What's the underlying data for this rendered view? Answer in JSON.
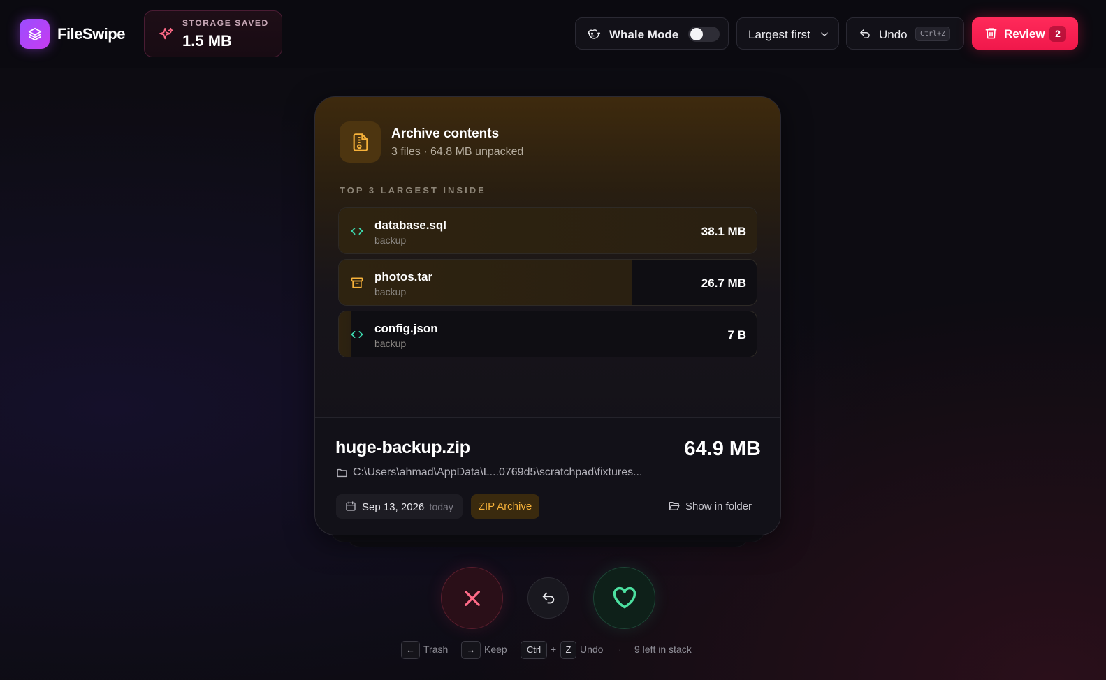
{
  "app": {
    "name": "FileSwipe"
  },
  "colors": {
    "accent": "#ff2a5a",
    "keep": "#4ce0a0",
    "trash": "#ff6b88",
    "archive": "#f7b23a",
    "code": "#3ddbb0"
  },
  "header": {
    "storage_saved_label": "STORAGE SAVED",
    "storage_saved_value": "1.5 MB",
    "whale_mode_label": "Whale Mode",
    "whale_mode_on": false,
    "sort_label": "Largest first",
    "undo_label": "Undo",
    "undo_shortcut": "Ctrl+Z",
    "review_label": "Review",
    "review_count": "2"
  },
  "card": {
    "archive_title": "Archive contents",
    "archive_subtitle": "3 files · 64.8 MB unpacked",
    "section_label": "TOP 3 LARGEST INSIDE",
    "files": [
      {
        "name": "database.sql",
        "category": "backup",
        "size": "38.1 MB",
        "icon": "code-icon",
        "fraction": 1.0
      },
      {
        "name": "photos.tar",
        "category": "backup",
        "size": "26.7 MB",
        "icon": "archive-box-icon",
        "fraction": 0.7
      },
      {
        "name": "config.json",
        "category": "backup",
        "size": "7 B",
        "icon": "code-icon",
        "fraction": 0.0
      }
    ],
    "file_name": "huge-backup.zip",
    "file_size": "64.9 MB",
    "path": "C:\\Users\\ahmad\\AppData\\L...0769d5\\scratchpad\\fixtures...",
    "date": "Sep 13, 2026",
    "date_relative": "· today",
    "type": "ZIP Archive",
    "show_in_folder": "Show in folder"
  },
  "hints": {
    "trash_key": "←",
    "trash_label": "Trash",
    "keep_key": "→",
    "keep_label": "Keep",
    "ctrl_key": "Ctrl",
    "plus": "+",
    "z_key": "Z",
    "undo_label": "Undo",
    "dot": "·",
    "stack_label": "9 left in stack"
  }
}
